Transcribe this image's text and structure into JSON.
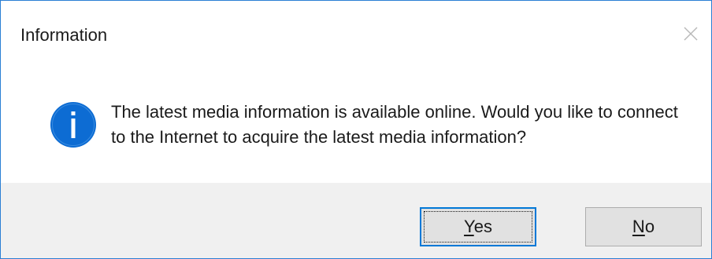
{
  "dialog": {
    "title": "Information",
    "close_icon": "close-icon",
    "message": "The latest media information is available online. Would you like to connect to the Internet to acquire the latest media information?",
    "icon": "info-icon",
    "colors": {
      "border": "#2a7fd4",
      "icon_fill": "#0d6cd3",
      "footer_bg": "#f0f0f0",
      "button_bg": "#e1e1e1",
      "focus_border": "#0078d7"
    },
    "buttons": {
      "yes": {
        "mnemonic": "Y",
        "rest": "es",
        "label": "Yes",
        "focused": true
      },
      "no": {
        "mnemonic": "N",
        "rest": "o",
        "label": "No",
        "focused": false
      }
    }
  }
}
